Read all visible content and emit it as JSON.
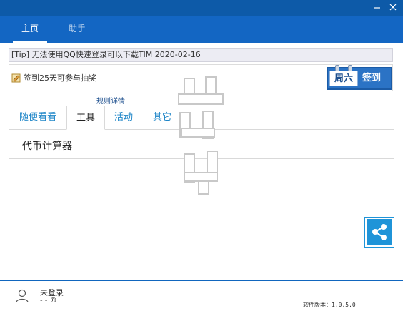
{
  "window": {
    "minimize_icon": "minimize-icon",
    "close_icon": "close-icon"
  },
  "nav": {
    "tabs": [
      {
        "label": "主页"
      },
      {
        "label": "助手"
      }
    ]
  },
  "tip": {
    "text": "[Tip] 无法使用QQ快速登录可以下载TIM  2020-02-16"
  },
  "signin": {
    "text": "签到25天可参与抽奖",
    "weekday": "周六",
    "button_label": "签到",
    "rules_link": "规则详情"
  },
  "tabs": [
    {
      "label": "随便看看"
    },
    {
      "label": "工具"
    },
    {
      "label": "活动"
    },
    {
      "label": "其它"
    }
  ],
  "tools": {
    "items": [
      {
        "label": "代币计算器"
      }
    ]
  },
  "user": {
    "name": "未登录",
    "sub": "- - ®"
  },
  "footer": {
    "version": "软件版本：1.0.5.0"
  },
  "colors": {
    "header": "#1366c3",
    "titlebar": "#0d5aa8",
    "accent": "#1f94d8"
  }
}
